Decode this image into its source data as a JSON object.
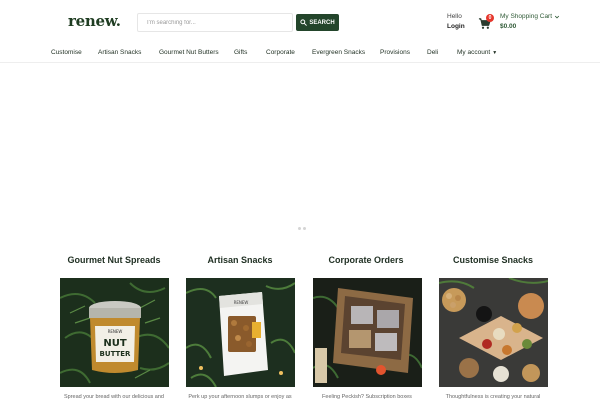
{
  "brand": {
    "logo_text": "renew."
  },
  "search": {
    "placeholder": "I'm searching for...",
    "button_label": "SEARCH"
  },
  "account": {
    "greeting": "Hello",
    "login_label": "Login"
  },
  "cart": {
    "title": "My Shopping Cart",
    "total": "$0.00",
    "count": "0"
  },
  "nav": {
    "items": [
      "Customise",
      "Artisan Snacks",
      "Gourmet Nut Butters",
      "Gifts",
      "Corporate",
      "Evergreen Snacks",
      "Provisions",
      "Deli"
    ],
    "account_menu": "My account"
  },
  "categories": [
    {
      "title": "Gourmet Nut Spreads",
      "desc": "Spread your bread with our delicious and",
      "jar_label_top": "RENEW",
      "jar_label_mid": "NUT",
      "jar_label_bottom": "BUTTER"
    },
    {
      "title": "Artisan Snacks",
      "desc": "Perk up your afternoon slumps or enjoy as",
      "pouch_label": "RENEW"
    },
    {
      "title": "Corporate Orders",
      "desc": "Feeling Peckish? Subscription boxes"
    },
    {
      "title": "Customise Snacks",
      "desc": "Thoughtfulness is creating your natural"
    }
  ],
  "colors": {
    "brand_green": "#23452b",
    "accent_red": "#e6362c"
  }
}
